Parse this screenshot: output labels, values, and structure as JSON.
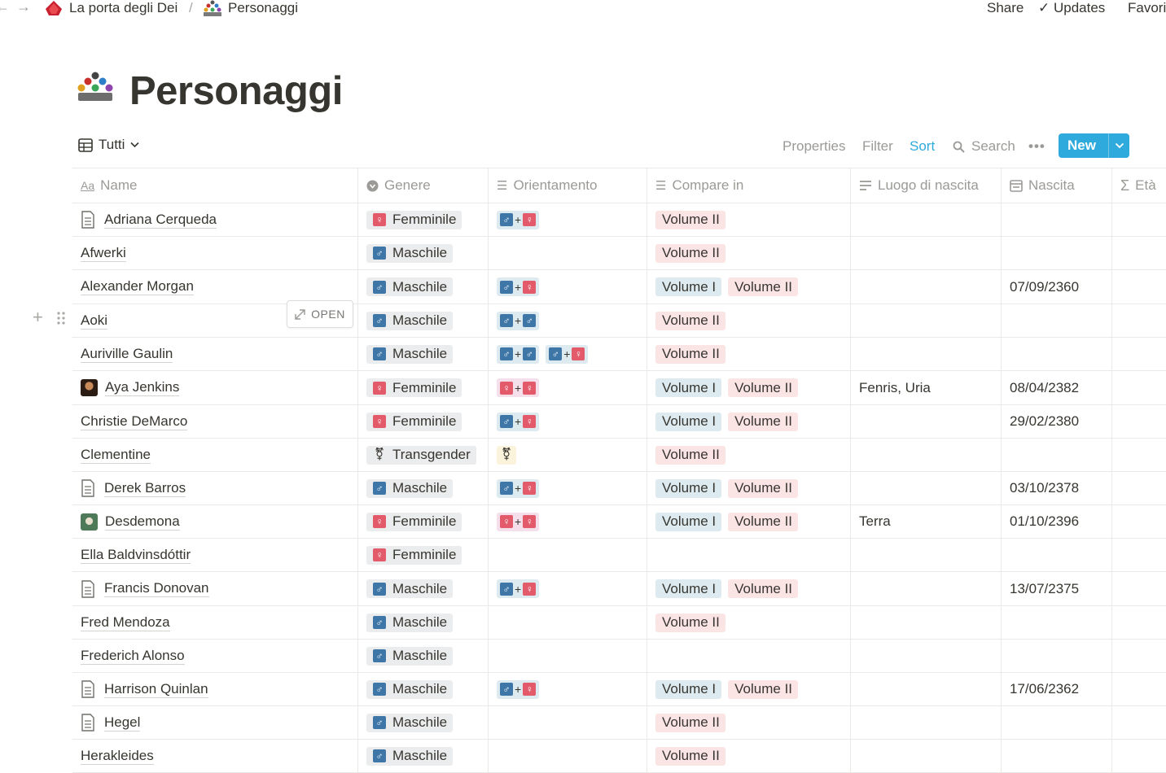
{
  "breadcrumb": {
    "workspace": "La porta degli Dei",
    "page": "Personaggi",
    "separator": "/"
  },
  "topbar": {
    "share": "Share",
    "updates": "Updates",
    "favorite": "Favori"
  },
  "page": {
    "title": "Personaggi"
  },
  "view": {
    "name": "Tutti",
    "properties": "Properties",
    "filter": "Filter",
    "sort": "Sort",
    "search": "Search",
    "new": "New",
    "row_open": "OPEN"
  },
  "columns": {
    "name": "Name",
    "genere": "Genere",
    "orientamento": "Orientamento",
    "compare_in": "Compare in",
    "luogo": "Luogo di nascita",
    "nascita": "Nascita",
    "eta": "Età"
  },
  "colors": {
    "accent": "#2eaadc",
    "male": "#3e76a8",
    "female": "#e35a6b",
    "volume_i": "#ddebf1",
    "volume_ii": "#fbe4e4"
  },
  "tags": {
    "female": "Femminile",
    "male": "Maschile",
    "trans": "Transgender",
    "vol1": "Volume I",
    "vol2": "Volume II",
    "plus": "+",
    "sym_m": "♂",
    "sym_f": "♀",
    "sym_t": "⚧"
  },
  "rows": [
    {
      "name": "Adriana Cerqueda",
      "icon": "doc-icon",
      "genere": "female",
      "orientamento": [
        [
          "m",
          "f"
        ]
      ],
      "compare": [
        "vol2"
      ],
      "luogo": "",
      "nascita": ""
    },
    {
      "name": "Afwerki",
      "icon": "",
      "genere": "male",
      "orientamento": [],
      "compare": [
        "vol2"
      ],
      "luogo": "",
      "nascita": ""
    },
    {
      "name": "Alexander Morgan",
      "icon": "",
      "genere": "male",
      "orientamento": [
        [
          "m",
          "f"
        ]
      ],
      "compare": [
        "vol1",
        "vol2"
      ],
      "luogo": "",
      "nascita": "07/09/2360"
    },
    {
      "name": "Aoki",
      "icon": "",
      "genere": "male",
      "orientamento": [
        [
          "m",
          "m"
        ]
      ],
      "compare": [
        "vol2"
      ],
      "luogo": "",
      "nascita": ""
    },
    {
      "name": "Auriville Gaulin",
      "icon": "",
      "genere": "male",
      "orientamento": [
        [
          "m",
          "m"
        ],
        [
          "m",
          "f"
        ]
      ],
      "compare": [
        "vol2"
      ],
      "luogo": "",
      "nascita": ""
    },
    {
      "name": "Aya Jenkins",
      "icon": "avatar-dark",
      "genere": "female",
      "orientamento": [
        [
          "f",
          "f"
        ]
      ],
      "compare": [
        "vol1",
        "vol2"
      ],
      "luogo": "Fenris, Uria",
      "nascita": "08/04/2382"
    },
    {
      "name": "Christie DeMarco",
      "icon": "",
      "genere": "female",
      "orientamento": [
        [
          "m",
          "f"
        ]
      ],
      "compare": [
        "vol1",
        "vol2"
      ],
      "luogo": "",
      "nascita": "29/02/2380"
    },
    {
      "name": "Clementine",
      "icon": "",
      "genere": "trans",
      "orientamento": [
        [
          "t"
        ]
      ],
      "compare": [
        "vol2"
      ],
      "luogo": "",
      "nascita": ""
    },
    {
      "name": "Derek Barros",
      "icon": "doc-icon",
      "genere": "male",
      "orientamento": [
        [
          "m",
          "f"
        ]
      ],
      "compare": [
        "vol1",
        "vol2"
      ],
      "luogo": "",
      "nascita": "03/10/2378"
    },
    {
      "name": "Desdemona",
      "icon": "avatar-green",
      "genere": "female",
      "orientamento": [
        [
          "f",
          "f"
        ]
      ],
      "compare": [
        "vol1",
        "vol2"
      ],
      "luogo": "Terra",
      "nascita": "01/10/2396"
    },
    {
      "name": "Ella Baldvinsdóttir",
      "icon": "",
      "genere": "female",
      "orientamento": [],
      "compare": [],
      "luogo": "",
      "nascita": ""
    },
    {
      "name": "Francis Donovan",
      "icon": "doc-icon",
      "genere": "male",
      "orientamento": [
        [
          "m",
          "f"
        ]
      ],
      "compare": [
        "vol1",
        "vol2"
      ],
      "luogo": "",
      "nascita": "13/07/2375"
    },
    {
      "name": "Fred Mendoza",
      "icon": "",
      "genere": "male",
      "orientamento": [],
      "compare": [
        "vol2"
      ],
      "luogo": "",
      "nascita": ""
    },
    {
      "name": "Frederich Alonso",
      "icon": "",
      "genere": "male",
      "orientamento": [],
      "compare": [],
      "luogo": "",
      "nascita": ""
    },
    {
      "name": "Harrison Quinlan",
      "icon": "doc-icon",
      "genere": "male",
      "orientamento": [
        [
          "m",
          "f"
        ]
      ],
      "compare": [
        "vol1",
        "vol2"
      ],
      "luogo": "",
      "nascita": "17/06/2362"
    },
    {
      "name": "Hegel",
      "icon": "doc-icon",
      "genere": "male",
      "orientamento": [],
      "compare": [
        "vol2"
      ],
      "luogo": "",
      "nascita": ""
    },
    {
      "name": "Herakleides",
      "icon": "",
      "genere": "male",
      "orientamento": [],
      "compare": [
        "vol2"
      ],
      "luogo": "",
      "nascita": ""
    }
  ]
}
